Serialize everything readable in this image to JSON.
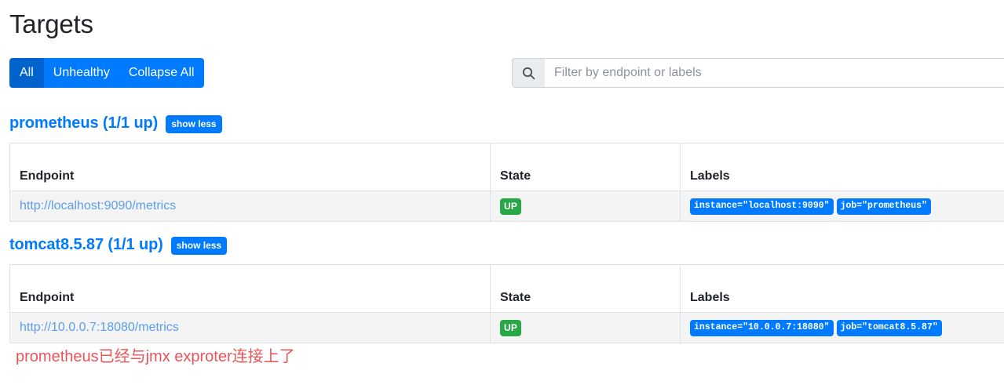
{
  "page": {
    "title": "Targets"
  },
  "toolbar": {
    "buttons": [
      {
        "label": "All",
        "active": true
      },
      {
        "label": "Unhealthy",
        "active": false
      },
      {
        "label": "Collapse All",
        "active": false
      }
    ],
    "search": {
      "icon": "search-icon",
      "placeholder": "Filter by endpoint or labels",
      "value": ""
    }
  },
  "columns": {
    "endpoint": "Endpoint",
    "state": "State",
    "labels": "Labels"
  },
  "jobs": [
    {
      "title": "prometheus (1/1 up)",
      "toggle_label": "show less",
      "rows": [
        {
          "endpoint": "http://localhost:9090/metrics",
          "state": "UP",
          "labels": [
            "instance=\"localhost:9090\"",
            "job=\"prometheus\""
          ]
        }
      ]
    },
    {
      "title": "tomcat8.5.87 (1/1 up)",
      "toggle_label": "show less",
      "rows": [
        {
          "endpoint": "http://10.0.0.7:18080/metrics",
          "state": "UP",
          "labels": [
            "instance=\"10.0.0.7:18080\"",
            "job=\"tomcat8.5.87\""
          ]
        }
      ]
    }
  ],
  "annotation": {
    "text": "prometheus已经与jmx exproter连接上了",
    "color": "#e8555a"
  },
  "colors": {
    "primary": "#007bff",
    "primary_active": "#0062cc",
    "success": "#28a745",
    "border": "#dee2e6",
    "row_bg": "#f4f4f4",
    "link": "#5c9ded"
  }
}
